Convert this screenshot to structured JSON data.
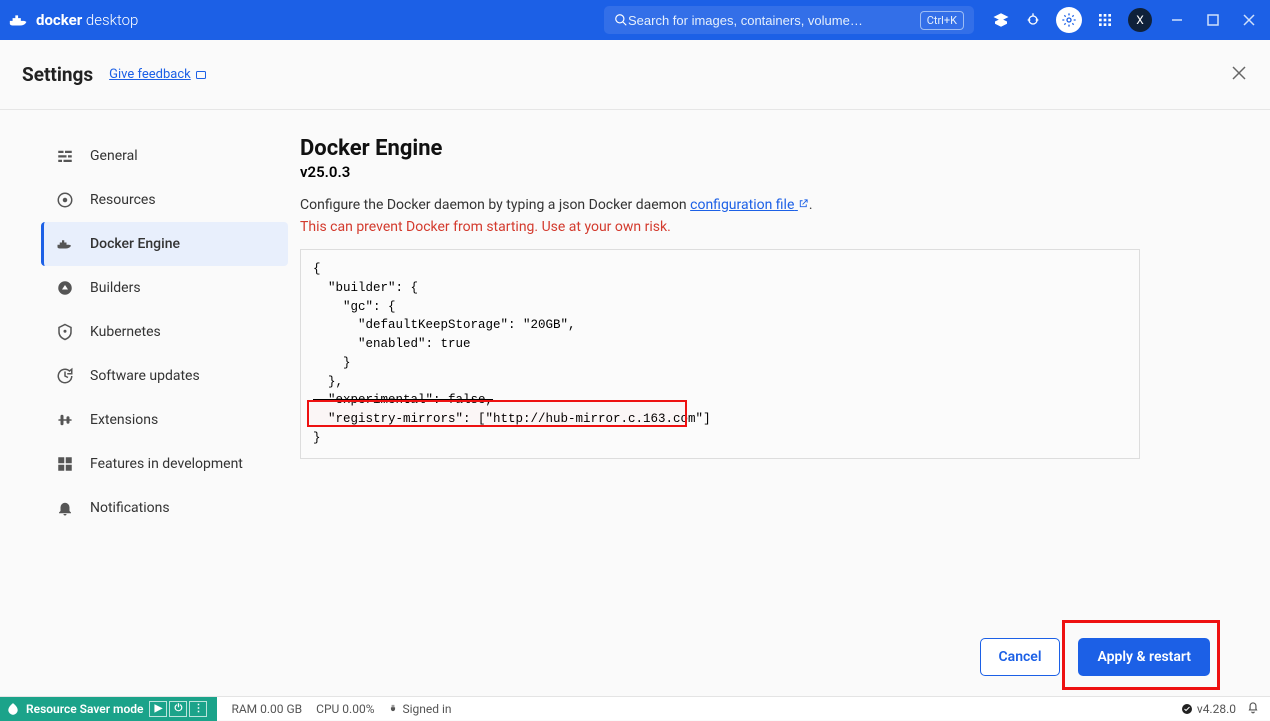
{
  "titlebar": {
    "logo_bold": "docker",
    "logo_light": "desktop",
    "search_placeholder": "Search for images, containers, volume…",
    "shortcut": "Ctrl+K",
    "avatar_letter": "X"
  },
  "header": {
    "title": "Settings",
    "feedback": "Give feedback"
  },
  "sidebar": {
    "items": [
      {
        "label": "General"
      },
      {
        "label": "Resources"
      },
      {
        "label": "Docker Engine"
      },
      {
        "label": "Builders"
      },
      {
        "label": "Kubernetes"
      },
      {
        "label": "Software updates"
      },
      {
        "label": "Extensions"
      },
      {
        "label": "Features in development"
      },
      {
        "label": "Notifications"
      }
    ],
    "active_index": 2
  },
  "content": {
    "heading": "Docker Engine",
    "version": "v25.0.3",
    "desc_pre": "Configure the Docker daemon by typing a json Docker daemon ",
    "desc_link": "configuration file",
    "desc_post": ".",
    "warning": "This can prevent Docker from starting. Use at your own risk.",
    "json_lines": [
      "{",
      "  \"builder\": {",
      "    \"gc\": {",
      "      \"defaultKeepStorage\": \"20GB\",",
      "      \"enabled\": true",
      "    }",
      "  },",
      "  \"experimental\": false,",
      "  \"registry-mirrors\": [\"http://hub-mirror.c.163.com\"]",
      "}"
    ],
    "json_struck_line_index": 7,
    "highlight_line_start": 8,
    "highlight_line_end": 8
  },
  "actions": {
    "cancel": "Cancel",
    "apply": "Apply & restart"
  },
  "footer": {
    "saver": "Resource Saver mode",
    "ram": "RAM 0.00 GB",
    "cpu": "CPU 0.00%",
    "signed": "Signed in",
    "version": "v4.28.0"
  }
}
